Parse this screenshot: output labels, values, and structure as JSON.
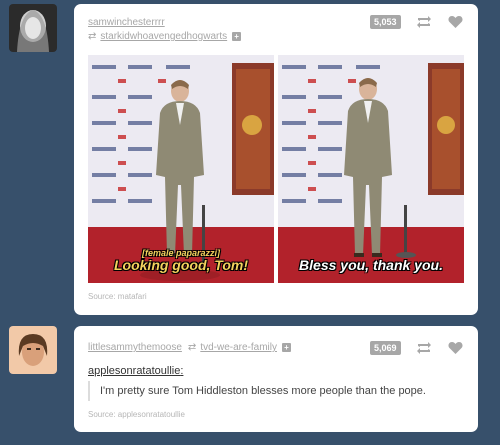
{
  "posts": [
    {
      "username": "samwinchesterrrr",
      "reblogged_from": "starkidwhoavengedhogwarts",
      "note_count": "5,053",
      "images": [
        {
          "caption_small": "[female paparazzi]",
          "caption": "Looking good, Tom!"
        },
        {
          "caption": "Bless you, thank you."
        }
      ],
      "source": "Source: matafari",
      "colors": {
        "carpet": "#b2222b",
        "backdrop": "#eceaf2",
        "suit": "#8f8a74"
      }
    },
    {
      "username": "littlesammythemoose",
      "reblogged_from": "tvd-we-are-family",
      "note_count": "5,069",
      "quote_author": "applesonratatoullie",
      "quote_text": "I'm pretty sure Tom Hiddleston blesses more people than the pope.",
      "source": "Source: applesonratatoullie"
    }
  ],
  "icons": {
    "reblog": "reblog-icon",
    "like": "heart-icon",
    "add": "plus-icon"
  },
  "theme": {
    "dashboard_bg": "#37506b",
    "card_bg": "#ffffff",
    "muted": "#a7a7a7"
  }
}
